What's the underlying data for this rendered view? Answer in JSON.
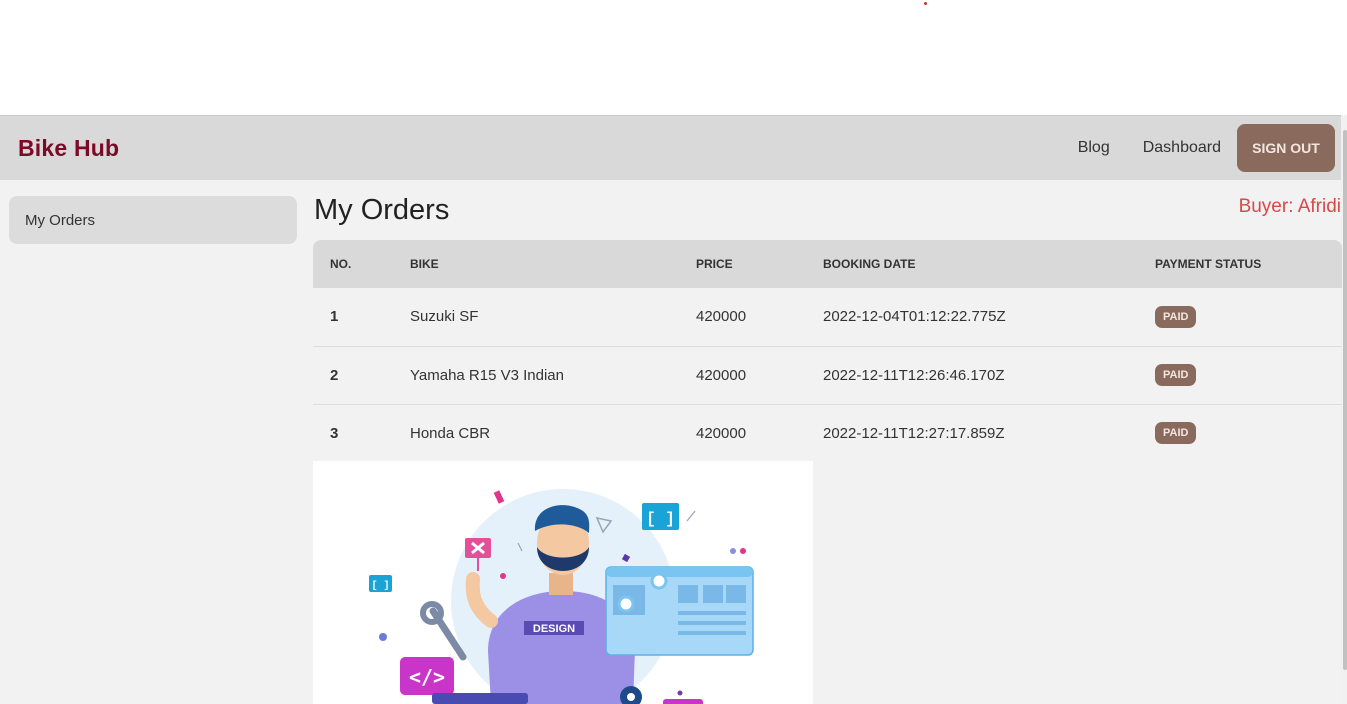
{
  "header": {
    "brand": "Bike Hub",
    "nav": {
      "blog": "Blog",
      "dashboard": "Dashboard"
    },
    "signout_label": "SIGN OUT"
  },
  "sidebar": {
    "items": [
      {
        "label": "My Orders"
      }
    ]
  },
  "main": {
    "title": "My Orders",
    "buyer": "Buyer: Afridi",
    "table": {
      "columns": [
        "NO.",
        "BIKE",
        "PRICE",
        "BOOKING DATE",
        "PAYMENT STATUS"
      ],
      "rows": [
        {
          "no": "1",
          "bike": "Suzuki SF",
          "price": "420000",
          "date": "2022-12-04T01:12:22.775Z",
          "status": "PAID"
        },
        {
          "no": "2",
          "bike": "Yamaha R15 V3 Indian",
          "price": "420000",
          "date": "2022-12-11T12:26:46.170Z",
          "status": "PAID"
        },
        {
          "no": "3",
          "bike": "Honda CBR",
          "price": "420000",
          "date": "2022-12-11T12:27:17.859Z",
          "status": "PAID"
        }
      ]
    },
    "illustration": {
      "shirt_text": "DESIGN",
      "code_text": "</>",
      "bracket_text": "[ ]"
    }
  },
  "colors": {
    "brand": "#7a0a26",
    "accent": "#8a6a5c",
    "buyer": "#d94848"
  }
}
